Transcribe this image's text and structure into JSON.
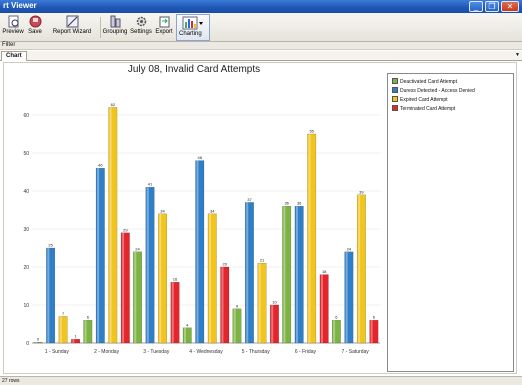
{
  "window": {
    "title": "rt Viewer"
  },
  "toolbar": {
    "buttons": [
      {
        "label": "Preview",
        "icon": "preview-icon"
      },
      {
        "label": "Save",
        "icon": "save-icon"
      },
      {
        "label": "Report Wizard",
        "icon": "report-wizard-icon"
      },
      {
        "label": "Grouping",
        "icon": "grouping-icon"
      },
      {
        "label": "Settings",
        "icon": "settings-icon"
      },
      {
        "label": "Export",
        "icon": "export-icon"
      },
      {
        "label": "Charting",
        "icon": "bar-chart-icon"
      }
    ]
  },
  "filter": {
    "label": "Filter"
  },
  "tabs": {
    "chart": "Chart"
  },
  "status": {
    "rows": "27 rows"
  },
  "colors": {
    "deactivated": "#7cb342",
    "duress": "#2f7fc8",
    "expired": "#f2c41e",
    "terminated": "#e4262c"
  },
  "chart_data": {
    "type": "bar",
    "title": "July 08, Invalid Card Attempts",
    "categories": [
      "1 - Sunday",
      "2 - Monday",
      "3 - Tuesday",
      "4 - Wednesday",
      "5 - Thursday",
      "6 - Friday",
      "7 - Saturday"
    ],
    "series": [
      {
        "name": "Deactivated Card Attempt",
        "color": "#7cb342",
        "values": [
          0,
          6,
          24,
          4,
          9,
          36,
          6
        ]
      },
      {
        "name": "Duress Detected - Access Denied",
        "color": "#2f7fc8",
        "values": [
          25,
          46,
          41,
          48,
          37,
          36,
          24
        ]
      },
      {
        "name": "Expired Card Attempt",
        "color": "#f2c41e",
        "values": [
          7,
          62,
          34,
          34,
          21,
          55,
          39
        ]
      },
      {
        "name": "Terminated Card Attempt",
        "color": "#e4262c",
        "values": [
          1,
          29,
          16,
          20,
          10,
          18,
          6
        ]
      }
    ],
    "ylim": [
      0,
      70
    ],
    "yticks": [
      0,
      10,
      20,
      30,
      40,
      50,
      60
    ],
    "grid": true,
    "legend": "right"
  }
}
